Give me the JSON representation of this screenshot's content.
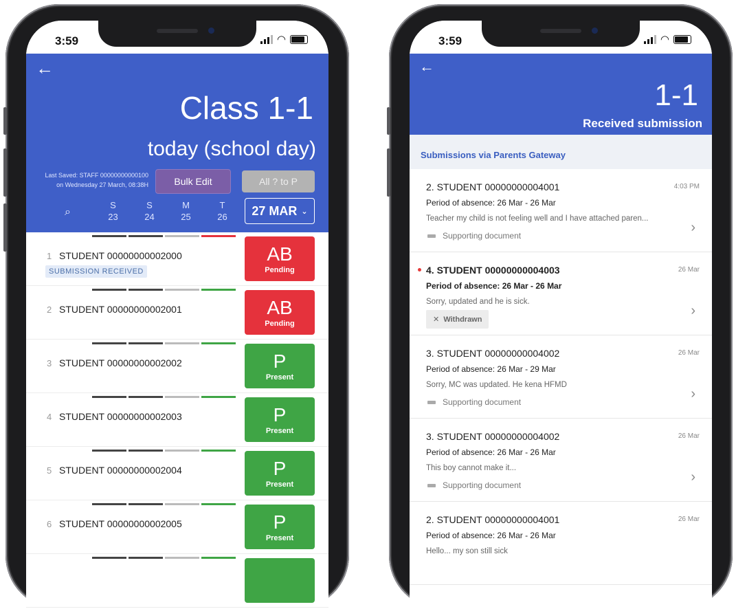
{
  "left": {
    "status_time": "3:59",
    "class_title": "Class 1-1",
    "day_title": "today (school day)",
    "last_saved_line1": "Last Saved: STAFF 00000000000100",
    "last_saved_line2": "on Wednesday 27 March, 08:38H",
    "bulk_edit_label": "Bulk Edit",
    "all_present_label": "All ? to P",
    "days": [
      {
        "letter": "S",
        "num": "23"
      },
      {
        "letter": "S",
        "num": "24"
      },
      {
        "letter": "M",
        "num": "25"
      },
      {
        "letter": "T",
        "num": "26"
      }
    ],
    "date_label": "27 MAR",
    "submission_badge": "SUBMISSION RECEIVED",
    "students": [
      {
        "num": "1",
        "name": "STUDENT 00000000002000",
        "code": "AB",
        "status": "Pending"
      },
      {
        "num": "2",
        "name": "STUDENT 00000000002001",
        "code": "AB",
        "status": "Pending"
      },
      {
        "num": "3",
        "name": "STUDENT 00000000002002",
        "code": "P",
        "status": "Present"
      },
      {
        "num": "4",
        "name": "STUDENT 00000000002003",
        "code": "P",
        "status": "Present"
      },
      {
        "num": "5",
        "name": "STUDENT 00000000002004",
        "code": "P",
        "status": "Present"
      },
      {
        "num": "6",
        "name": "STUDENT 00000000002005",
        "code": "P",
        "status": "Present"
      }
    ],
    "colors": {
      "header": "#3f5fc8",
      "absent": "#e5323c",
      "present": "#3fa545",
      "bulk": "#7b5ea7"
    }
  },
  "right": {
    "status_time": "3:59",
    "class_title": "1-1",
    "subtitle": "Received submission",
    "section_label": "Submissions via Parents Gateway",
    "doc_label": "Supporting document",
    "withdrawn_label": "Withdrawn",
    "submissions": [
      {
        "name": "2. STUDENT 00000000004001",
        "time": "4:03 PM",
        "period": "Period of absence: 26 Mar - 26 Mar",
        "message": "Teacher my child is not feeling well and I have attached paren..."
      },
      {
        "name": "4. STUDENT 00000000004003",
        "time": "26 Mar",
        "period": "Period of absence: 26 Mar - 26 Mar",
        "message": "Sorry, updated and he is sick."
      },
      {
        "name": "3. STUDENT 00000000004002",
        "time": "26 Mar",
        "period": "Period of absence: 26 Mar - 29 Mar",
        "message": "Sorry, MC was updated. He kena HFMD"
      },
      {
        "name": "3. STUDENT 00000000004002",
        "time": "26 Mar",
        "period": "Period of absence: 26 Mar - 26 Mar",
        "message": "This boy cannot make it..."
      },
      {
        "name": "2. STUDENT 00000000004001",
        "time": "26 Mar",
        "period": "Period of absence: 26 Mar - 26 Mar",
        "message": "Hello... my son still sick"
      }
    ]
  }
}
